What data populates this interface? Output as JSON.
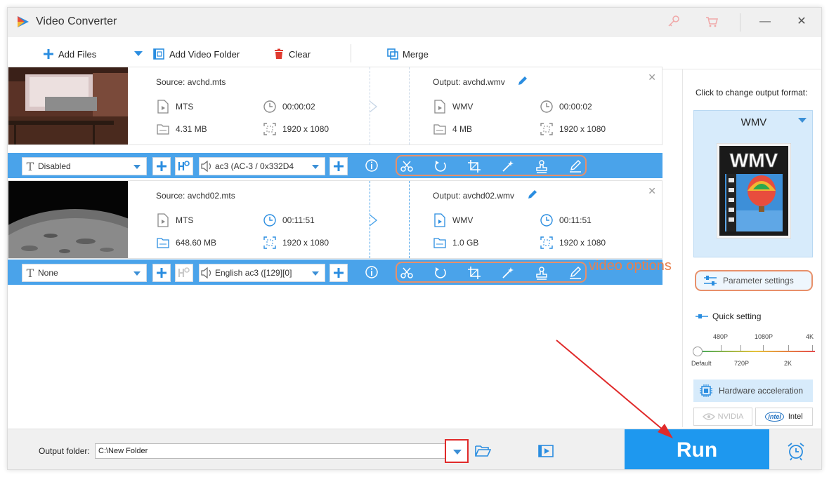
{
  "window": {
    "title": "Video Converter",
    "close_glyph": "✕",
    "minimize_glyph": "—"
  },
  "toolbar": {
    "add_files": "Add Files",
    "add_video_folder": "Add Video Folder",
    "clear": "Clear",
    "merge": "Merge"
  },
  "items": [
    {
      "source_title": "Source: avchd.mts",
      "output_title": "Output: avchd.wmv",
      "src_format": "MTS",
      "src_duration": "00:00:02",
      "src_size": "4.31 MB",
      "src_resolution": "1920 x 1080",
      "out_format": "WMV",
      "out_duration": "00:00:02",
      "out_size": "4 MB",
      "out_resolution": "1920 x 1080",
      "subtitle": "Disabled",
      "audio": "ac3 (AC-3 / 0x332D4"
    },
    {
      "source_title": "Source: avchd02.mts",
      "output_title": "Output: avchd02.wmv",
      "src_format": "MTS",
      "src_duration": "00:11:51",
      "src_size": "648.60 MB",
      "src_resolution": "1920 x 1080",
      "out_format": "WMV",
      "out_duration": "00:11:51",
      "out_size": "1.0 GB",
      "out_resolution": "1920 x 1080",
      "subtitle": "None",
      "audio": "English ac3 ([129][0]"
    }
  ],
  "annotation": {
    "video_options": "video options"
  },
  "right_panel": {
    "hint": "Click to change output format:",
    "format_name": "WMV",
    "format_art_text": "WMV",
    "parameter_settings": "Parameter settings",
    "quick_setting": "Quick setting",
    "quality_top": [
      "480P",
      "1080P",
      "4K"
    ],
    "quality_bottom": [
      "Default",
      "720P",
      "2K"
    ],
    "hardware_acceleration": "Hardware acceleration",
    "nvidia": "NVIDIA",
    "intel_badge": "intel",
    "intel": "Intel"
  },
  "bottom": {
    "output_folder_label": "Output folder:",
    "output_folder_value": "C:\\New Folder",
    "run": "Run"
  },
  "colors": {
    "accent": "#1e98ef",
    "edit_bar": "#4aa3ea",
    "annotation_orange": "#e8804e",
    "annotation_red": "#e02a2a"
  }
}
